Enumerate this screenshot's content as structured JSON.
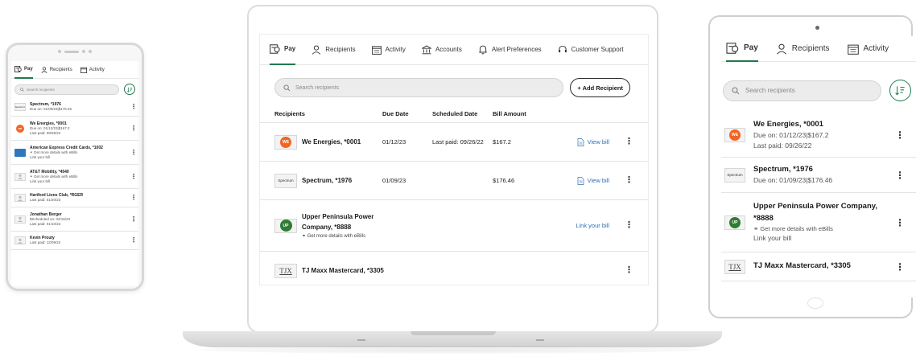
{
  "colors": {
    "accent": "#1f7a4d",
    "link": "#2c6fb3",
    "we_orange": "#f26522",
    "upper_green": "#2e7d32",
    "amex_blue": "#2e77bc"
  },
  "tabs": {
    "pay": "Pay",
    "recipients": "Recipients",
    "activity": "Activity",
    "accounts": "Accounts",
    "alerts": "Alert Preferences",
    "support": "Customer Support"
  },
  "search": {
    "placeholder": "Search recipients"
  },
  "add_recipient": "+ Add Recipient",
  "table": {
    "headers": {
      "recipients": "Recipients",
      "due_date": "Due Date",
      "scheduled_date": "Scheduled Date",
      "bill_amount": "Bill Amount"
    }
  },
  "laptop_rows": [
    {
      "name": "We Energies, *0001",
      "due": "01/12/23",
      "scheduled": "Last paid: 09/26/22",
      "amount": "$167.2",
      "action": "View bill",
      "logo": "we-energies-logo"
    },
    {
      "name": "Spectrum, *1976",
      "due": "01/09/23",
      "scheduled": "",
      "amount": "$176.46",
      "action": "View bill",
      "logo": "spectrum-logo"
    },
    {
      "name_line1": "Upper Peninsula Power",
      "name_line2": "Company, *8888",
      "sub": "Get more details with eBills",
      "action": "Link your bill",
      "logo": "upper-peninsula-logo"
    },
    {
      "name": "TJ Maxx Mastercard, *3305",
      "logo": "tjx-logo"
    }
  ],
  "phone_items": [
    {
      "name": "Spectrum, *1976",
      "line1": "Due on: 01/09/23|$176.46"
    },
    {
      "name": "We Energies, *0001",
      "line1": "Due on: 01/12/23|$167.2",
      "line2": "Last paid: 09/26/22"
    },
    {
      "name": "American Express Credit Cards, *1002",
      "line1": "Get more details with eBills",
      "line2": "Link your bill"
    },
    {
      "name": "AT&T Mobility, *4540",
      "line1": "Get more details with eBills",
      "line2": "Link your bill"
    },
    {
      "name": "Hartford Lions Club, *RGER",
      "line1": "Last paid: 01/20/23"
    },
    {
      "name": "Jonathan Berger",
      "line1": "Scheduled on: 02/15/23",
      "line2": "Last paid: 01/10/23"
    },
    {
      "name": "Kevin Prouty",
      "line1": "Last paid: 12/09/22"
    }
  ],
  "tablet_items": [
    {
      "name": "We Energies, *0001",
      "line1": "Due on: 01/12/23|$167.2",
      "line2": "Last paid: 09/26/22"
    },
    {
      "name": "Spectrum, *1976",
      "line1": "Due on: 01/09/23|$176.46"
    },
    {
      "name_line1": "Upper Peninsula Power Company,",
      "name_line2": "*8888",
      "line1": "Get more details with eBills",
      "line2": "Link your bill"
    },
    {
      "name": "TJ Maxx Mastercard, *3305"
    }
  ],
  "logos": {
    "we_text": "WE",
    "spectrum_text": "Spectrum",
    "tjx_text": "TJX",
    "upper_text": "UP"
  }
}
